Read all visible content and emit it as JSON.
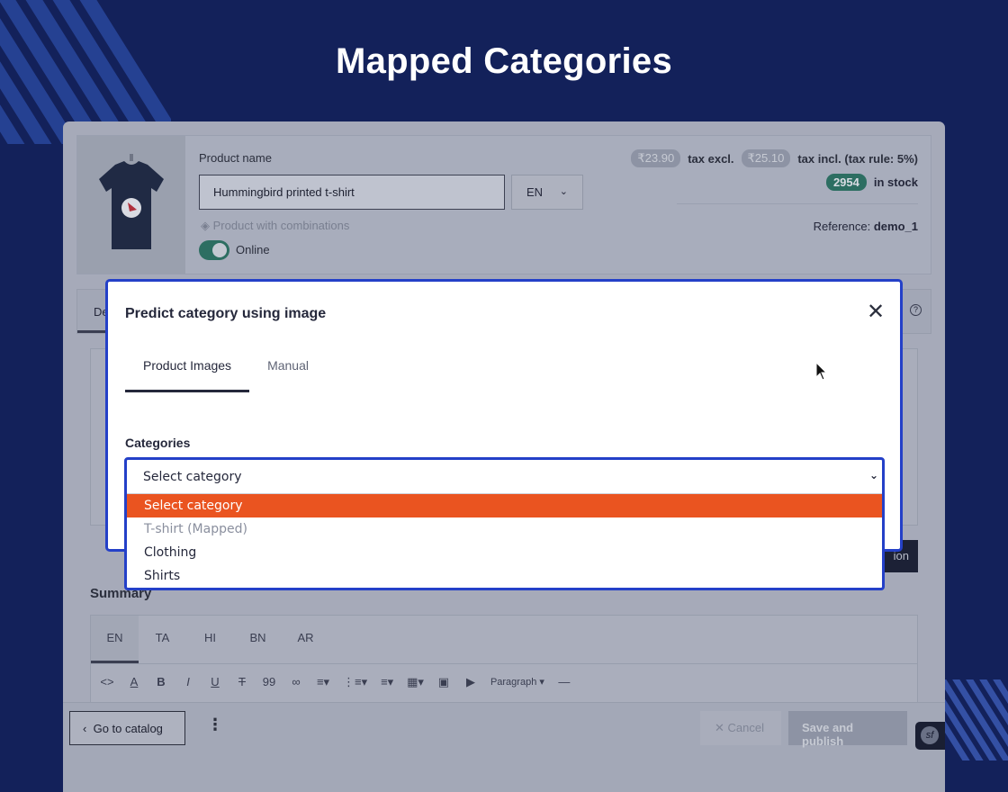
{
  "hero": {
    "title": "Mapped Categories"
  },
  "product": {
    "name_label": "Product name",
    "name_value": "Hummingbird printed t-shirt",
    "language": "EN",
    "combinations_text": "Product with combinations",
    "online_label": "Online",
    "online": true,
    "price_excl": "₹23.90",
    "price_excl_label": "tax excl.",
    "price_incl": "₹25.10",
    "price_incl_label": "tax incl. (tax rule: 5%)",
    "stock_count": "2954",
    "stock_label": "in stock",
    "reference_label": "Reference:",
    "reference_value": "demo_1"
  },
  "page": {
    "tab_partial": "De",
    "button_partial": "ion",
    "summary_label": "Summary",
    "summary_langs": [
      "EN",
      "TA",
      "HI",
      "BN",
      "AR"
    ],
    "toolbar_paragraph": "Paragraph"
  },
  "footer": {
    "catalog_label": "Go to catalog",
    "cancel_label": "Cancel",
    "publish_label": "Save and publish"
  },
  "modal": {
    "title": "Predict category using image",
    "tabs": [
      {
        "label": "Product Images",
        "active": true
      },
      {
        "label": "Manual",
        "active": false
      }
    ],
    "categories_label": "Categories",
    "select_value": "Select category",
    "options": [
      {
        "label": "Select category",
        "state": "selected"
      },
      {
        "label": "T-shirt (Mapped)",
        "state": "disabled"
      },
      {
        "label": "Clothing",
        "state": "normal"
      },
      {
        "label": "Shirts",
        "state": "normal"
      }
    ]
  },
  "colors": {
    "background": "#13215a",
    "accent_blue": "#2440c8",
    "option_highlight": "#ea5420",
    "online_green": "#2d6e62"
  }
}
